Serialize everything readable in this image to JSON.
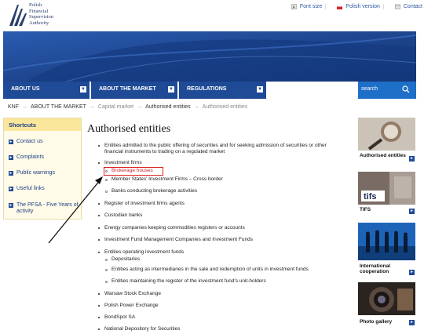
{
  "header": {
    "logo_lines": [
      "Polish",
      "Financial",
      "Supervision",
      "Authority"
    ],
    "top_links": [
      {
        "label": "Font size",
        "icon": "font-size-icon"
      },
      {
        "label": "Polish version",
        "icon": "flag-icon"
      },
      {
        "label": "Contact",
        "icon": "contact-icon"
      }
    ]
  },
  "nav": {
    "items": [
      "ABOUT US",
      "ABOUT THE MARKET",
      "REGULATIONS"
    ],
    "search_placeholder": "search"
  },
  "breadcrumb": [
    "KNF",
    "ABOUT THE MARKET",
    "Capital market",
    "Authorised entities",
    "Authorised entities"
  ],
  "sidebar": {
    "title": "Shortcuts",
    "items": [
      "Contact us",
      "Complaints",
      "Public warnings",
      "Useful links",
      "The PFSA - Five Years of activity"
    ]
  },
  "main": {
    "title": "Authorised entities",
    "entries": [
      "Entities admitted to the public offering of securities and for seeking admission of securities or other",
      "financial instruments to trading on a regulated market",
      "Investment firms",
      "Brokerage houses",
      "Member States' Investment Firms – Cross border",
      "Banks conducting brokerage activities",
      "Register of investment firms agents",
      "Custodian banks",
      "Energy companies keeping commodities registers or accounts",
      "Investment Fund Management Companies and Investment Funds",
      "Entities operating investment funds",
      "Depositaries",
      "Entities acting as intermediaries in the sale and redemption of units in investment funds",
      "Entities maintaining the register of the investment fund's unit-holders",
      "Warsaw Stock Exchange",
      "Polish Power Exchange",
      "BondSpot SA",
      "National Depository for Securities"
    ]
  },
  "right_column": {
    "labels": [
      "Authorised entities",
      "TIFS",
      "International cooperation",
      "Photo gallery"
    ],
    "tifs_logo_text": "tifs"
  },
  "colors": {
    "nav_blue": "#1e4a96",
    "banner_blue": "#1b3f85",
    "highlight_red": "#d22",
    "shortcuts_bg": "#fffbe8"
  }
}
